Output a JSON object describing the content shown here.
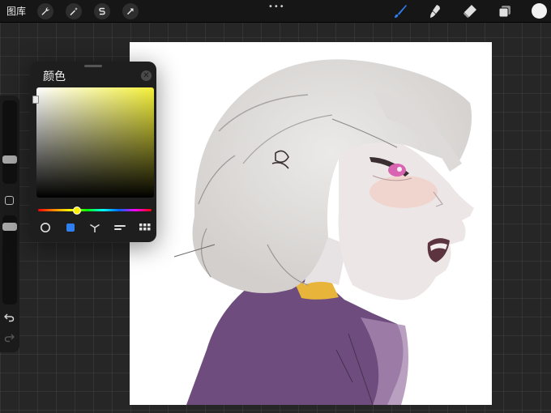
{
  "topbar": {
    "gallery_label": "图库",
    "tools_left": [
      "wrench-icon",
      "magic-wand-icon",
      "selection-s-icon",
      "transform-arrow-icon"
    ],
    "tools_right": [
      "brush-icon",
      "smudge-icon",
      "eraser-icon",
      "layers-icon"
    ],
    "current_color": "#f1f1f1",
    "brush_accent": "#2f7ff0"
  },
  "color_panel": {
    "title": "颜色",
    "hue_color": "#f4f03a",
    "selected_mode_color": "#2f7ff0",
    "modes": [
      "disc-mode",
      "classic-mode",
      "harmony-mode",
      "value-mode",
      "palettes-mode"
    ]
  }
}
